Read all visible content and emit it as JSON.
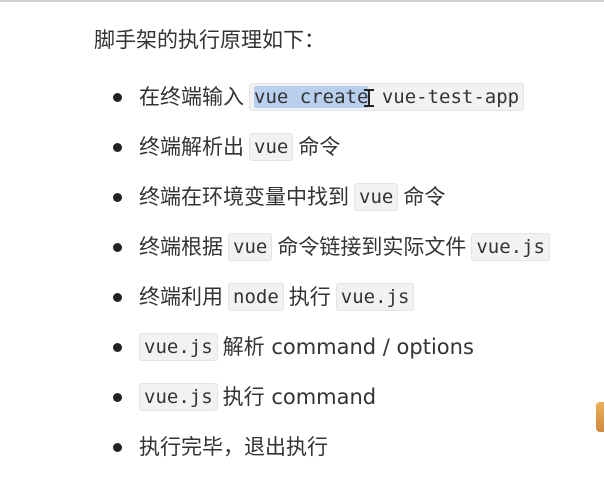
{
  "heading": "脚手架的执行原理如下：",
  "items": [
    {
      "pre": "在终端输入",
      "code_selected": "vue create",
      "code_rest": " vue-test-app"
    },
    {
      "pre": "终端解析出",
      "code": "vue",
      "post": "命令"
    },
    {
      "pre": "终端在环境变量中找到",
      "code": "vue",
      "post": "命令"
    },
    {
      "pre": "终端根据",
      "code": "vue",
      "mid": "命令链接到实际文件",
      "code2": "vue.js"
    },
    {
      "pre": "终端利用",
      "code": "node",
      "mid": "执行",
      "code2": "vue.js"
    },
    {
      "code": "vue.js",
      "post": "解析 command / options"
    },
    {
      "code": "vue.js",
      "post": "执行 command"
    },
    {
      "pre": "执行完毕，退出执行"
    }
  ]
}
